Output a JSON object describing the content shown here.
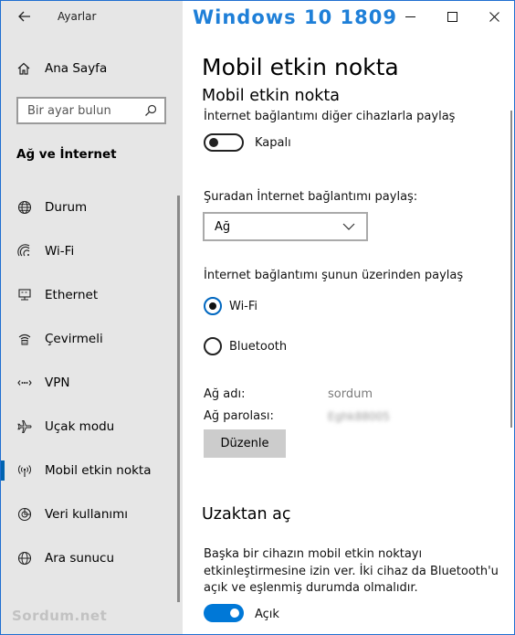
{
  "window": {
    "app_title": "Ayarlar",
    "overlay_title": "Windows 10 1809"
  },
  "sidebar": {
    "home_label": "Ana Sayfa",
    "search_placeholder": "Bir ayar bulun",
    "section_title": "Ağ ve İnternet",
    "items": [
      {
        "label": "Durum",
        "icon": "globe-icon"
      },
      {
        "label": "Wi-Fi",
        "icon": "wifi-icon"
      },
      {
        "label": "Ethernet",
        "icon": "ethernet-icon"
      },
      {
        "label": "Çevirmeli",
        "icon": "dialup-icon"
      },
      {
        "label": "VPN",
        "icon": "vpn-icon"
      },
      {
        "label": "Uçak modu",
        "icon": "airplane-icon"
      },
      {
        "label": "Mobil etkin nokta",
        "icon": "hotspot-icon",
        "active": true
      },
      {
        "label": "Veri kullanımı",
        "icon": "data-usage-icon"
      },
      {
        "label": "Ara sunucu",
        "icon": "proxy-globe-icon"
      }
    ],
    "watermark": "Sordum.net"
  },
  "main": {
    "page_title": "Mobil etkin nokta",
    "sub_title": "Mobil etkin nokta",
    "share_desc": "İnternet bağlantımı diğer cihazlarla paylaş",
    "share_toggle_state": "Kapalı",
    "share_from_label": "Şuradan İnternet bağlantımı paylaş:",
    "share_from_value": "Ağ",
    "share_over_label": "İnternet bağlantımı şunun üzerinden paylaş",
    "radio_options": [
      "Wi-Fi",
      "Bluetooth"
    ],
    "selected_radio": "Wi-Fi",
    "network_name_label": "Ağ adı:",
    "network_name_value": "sordum",
    "network_password_label": "Ağ parolası:",
    "network_password_value": "Eghk88005",
    "edit_button": "Düzenle",
    "remote_title": "Uzaktan aç",
    "remote_desc": "Başka bir cihazın mobil etkin noktayı etkinleştirmesine izin ver. İki cihaz da Bluetooth'u açık ve eşlenmiş durumda olmalıdır.",
    "remote_toggle_state": "Açık"
  },
  "colors": {
    "accent": "#0078d7",
    "sidebar_bg": "#e6e6e6",
    "overlay_title": "#1e7fd8",
    "watermark": "#c2c2c2"
  }
}
